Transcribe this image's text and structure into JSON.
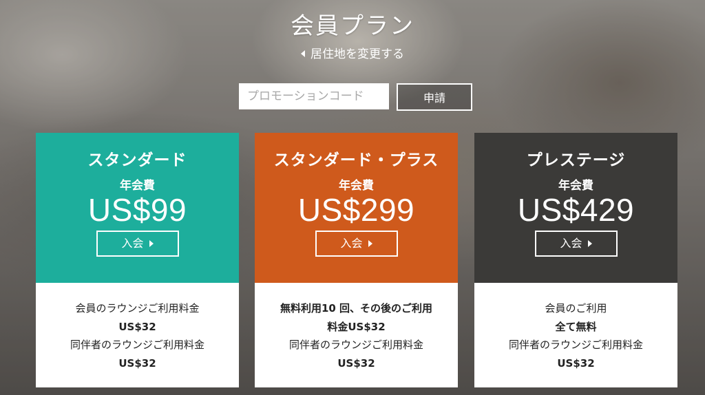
{
  "header": {
    "title": "会員プラン",
    "change_residence_label": "居住地を変更する"
  },
  "promo": {
    "placeholder": "プロモーションコード",
    "apply_label": "申請"
  },
  "colors": {
    "standard": "#1dae9c",
    "standard_plus": "#cf5a1c",
    "prestige": "#3b3a38"
  },
  "plans": [
    {
      "name": "スタンダード",
      "fee_label": "年会費",
      "price": "US$99",
      "join_label": "入会",
      "details": [
        "会員のラウンジご利用料金",
        "US$32",
        "同伴者のラウンジご利用料金",
        "US$32"
      ]
    },
    {
      "name": "スタンダード・プラス",
      "fee_label": "年会費",
      "price": "US$299",
      "join_label": "入会",
      "details": [
        "無料利用10 回、その後のご利用",
        "料金US$32",
        "同伴者のラウンジご利用料金",
        "US$32"
      ]
    },
    {
      "name": "プレステージ",
      "fee_label": "年会費",
      "price": "US$429",
      "join_label": "入会",
      "details": [
        "会員のご利用",
        "全て無料",
        "同伴者のラウンジご利用料金",
        "US$32"
      ]
    }
  ]
}
